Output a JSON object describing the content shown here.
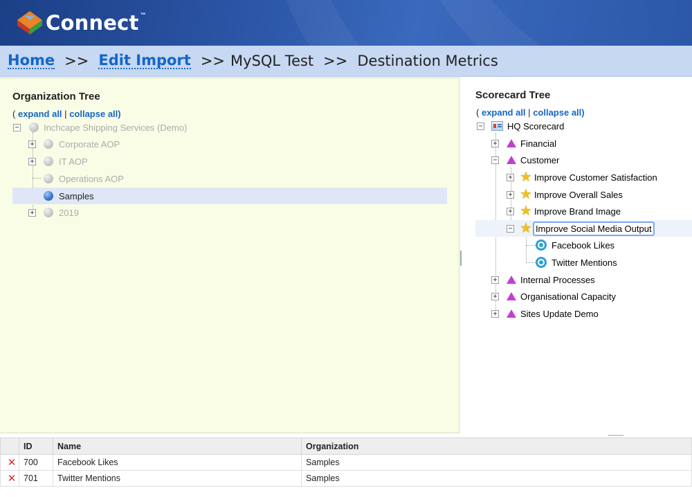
{
  "header": {
    "logo_text": "Connect",
    "logo_tm": "™"
  },
  "breadcrumb": {
    "home": "Home",
    "sep": ">>",
    "edit_import": "Edit Import",
    "mysql_test": "MySQL Test",
    "destination_metrics": "Destination Metrics"
  },
  "org_tree": {
    "title": "Organization Tree",
    "paren_open": "(",
    "expand_all": "expand all",
    "divider": "|",
    "collapse_all": "collapse all)",
    "root": "Inchcape Shipping Services (Demo)",
    "children": [
      "Corporate AOP",
      "IT AOP",
      "Operations AOP",
      "Samples",
      "2019"
    ],
    "selected": "Samples"
  },
  "scorecard_tree": {
    "title": "Scorecard Tree",
    "paren_open": "(",
    "expand_all": "expand all",
    "divider": "|",
    "collapse_all": "collapse all)",
    "root": "HQ Scorecard",
    "perspectives": [
      "Financial",
      "Customer",
      "Internal Processes",
      "Organisational Capacity",
      "Sites Update Demo"
    ],
    "objectives": [
      "Improve Customer Satisfaction",
      "Improve Overall Sales",
      "Improve Brand Image",
      "Improve Social Media Output"
    ],
    "metrics": [
      "Facebook Likes",
      "Twitter Mentions"
    ],
    "selected": "Improve Social Media Output"
  },
  "grid": {
    "columns": [
      "",
      "ID",
      "Name",
      "Organization"
    ],
    "rows": [
      {
        "id": "700",
        "name": "Facebook Likes",
        "organization": "Samples"
      },
      {
        "id": "701",
        "name": "Twitter Mentions",
        "organization": "Samples"
      }
    ],
    "delete_glyph": "✕"
  },
  "colors": {
    "header_blue": "#2b55a5",
    "breadcrumb_bg": "#c6d8f2",
    "link_blue": "#1565c8",
    "org_panel_bg": "#fafde5",
    "selected_row": "#dfe7f7",
    "perspective_magenta": "#c33fd2",
    "delete_red": "#d0312a"
  },
  "icons": {
    "logo": "connect-logo-icon",
    "org_node": "grey-ball-icon",
    "org_selected": "blue-ball-icon",
    "scorecard": "scorecard-icon",
    "perspective": "triangle-icon",
    "objective": "star-icon",
    "metric": "metric-circle-icon",
    "delete": "delete-x-icon"
  }
}
